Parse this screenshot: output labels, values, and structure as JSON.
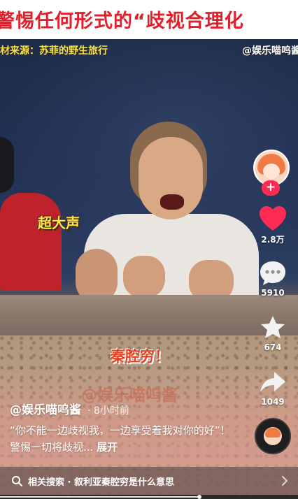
{
  "headline": {
    "text": "警惕任何形式的“歧视合理化"
  },
  "video": {
    "source_caption": "材来源：苏菲的野生旅行",
    "channel_watermark": "@娱乐喵呜酱",
    "sticker_loud": "超大声",
    "sticker_main": "秦腔穷！",
    "faded_watermark": "@娱乐喵呜酱"
  },
  "sidebar": {
    "follow_label": "+",
    "likes": "2.8万",
    "comments": "5910",
    "favorites": "674",
    "shares": "1049",
    "like_color": "#fe2c55"
  },
  "post": {
    "author": "@娱乐喵呜酱",
    "time": "· 8小时前",
    "description": "“你不能一边歧视我，一边享受着我对你的好”！警惕一切将歧视...",
    "expand_label": "展开"
  },
  "related_search": {
    "prefix": "相关搜索",
    "separator": " · ",
    "query": "叙利亚秦腔穷是什么意思"
  },
  "playback": {
    "progress": 0.67
  }
}
